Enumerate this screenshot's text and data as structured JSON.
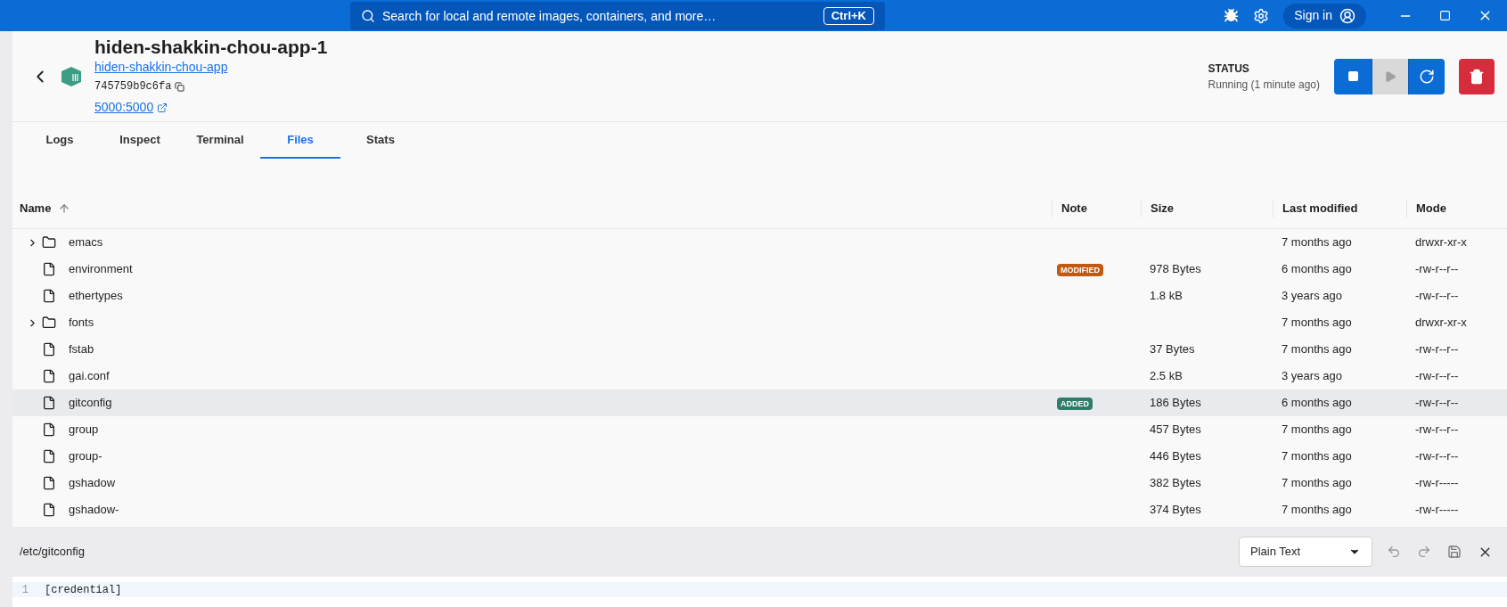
{
  "topbar": {
    "search_placeholder": "Search for local and remote images, containers, and more…",
    "shortcut": "Ctrl+K",
    "sign_in": "Sign in"
  },
  "container": {
    "name": "hiden-shakkin-chou-app-1",
    "project_link": "hiden-shakkin-chou-app",
    "id": "745759b9c6fa",
    "port_link": "5000:5000",
    "status_label": "STATUS",
    "status_text": "Running (1 minute ago)"
  },
  "actions": [
    {
      "kind": "stop",
      "disabled": false
    },
    {
      "kind": "start",
      "disabled": true
    },
    {
      "kind": "restart",
      "disabled": false
    },
    {
      "kind": "delete",
      "disabled": false
    }
  ],
  "tabs": [
    {
      "label": "Logs",
      "selected": false
    },
    {
      "label": "Inspect",
      "selected": false
    },
    {
      "label": "Terminal",
      "selected": false
    },
    {
      "label": "Files",
      "selected": true
    },
    {
      "label": "Stats",
      "selected": false
    }
  ],
  "table": {
    "columns": [
      "Name",
      "Note",
      "Size",
      "Last modified",
      "Mode"
    ],
    "rows": [
      {
        "kind": "folder",
        "name": "emacs",
        "note": null,
        "size": "",
        "modified": "7 months ago",
        "mode": "drwxr-xr-x",
        "selected": false
      },
      {
        "kind": "file",
        "name": "environment",
        "note": {
          "label": "MODIFIED",
          "color": "#c05a12"
        },
        "size": "978 Bytes",
        "modified": "6 months ago",
        "mode": "-rw-r--r--",
        "selected": false
      },
      {
        "kind": "file",
        "name": "ethertypes",
        "note": null,
        "size": "1.8 kB",
        "modified": "3 years ago",
        "mode": "-rw-r--r--",
        "selected": false
      },
      {
        "kind": "folder",
        "name": "fonts",
        "note": null,
        "size": "",
        "modified": "7 months ago",
        "mode": "drwxr-xr-x",
        "selected": false
      },
      {
        "kind": "file",
        "name": "fstab",
        "note": null,
        "size": "37 Bytes",
        "modified": "7 months ago",
        "mode": "-rw-r--r--",
        "selected": false
      },
      {
        "kind": "file",
        "name": "gai.conf",
        "note": null,
        "size": "2.5 kB",
        "modified": "3 years ago",
        "mode": "-rw-r--r--",
        "selected": false
      },
      {
        "kind": "file",
        "name": "gitconfig",
        "note": {
          "label": "ADDED",
          "color": "#2e7d6b"
        },
        "size": "186 Bytes",
        "modified": "6 months ago",
        "mode": "-rw-r--r--",
        "selected": true
      },
      {
        "kind": "file",
        "name": "group",
        "note": null,
        "size": "457 Bytes",
        "modified": "7 months ago",
        "mode": "-rw-r--r--",
        "selected": false
      },
      {
        "kind": "file",
        "name": "group-",
        "note": null,
        "size": "446 Bytes",
        "modified": "7 months ago",
        "mode": "-rw-r--r--",
        "selected": false
      },
      {
        "kind": "file",
        "name": "gshadow",
        "note": null,
        "size": "382 Bytes",
        "modified": "7 months ago",
        "mode": "-rw-r-----",
        "selected": false
      },
      {
        "kind": "file",
        "name": "gshadow-",
        "note": null,
        "size": "374 Bytes",
        "modified": "7 months ago",
        "mode": "-rw-r-----",
        "selected": false
      }
    ]
  },
  "editor": {
    "path": "/etc/gitconfig",
    "language": "Plain Text",
    "lines": [
      {
        "number": "1",
        "text": "[credential]"
      }
    ]
  }
}
